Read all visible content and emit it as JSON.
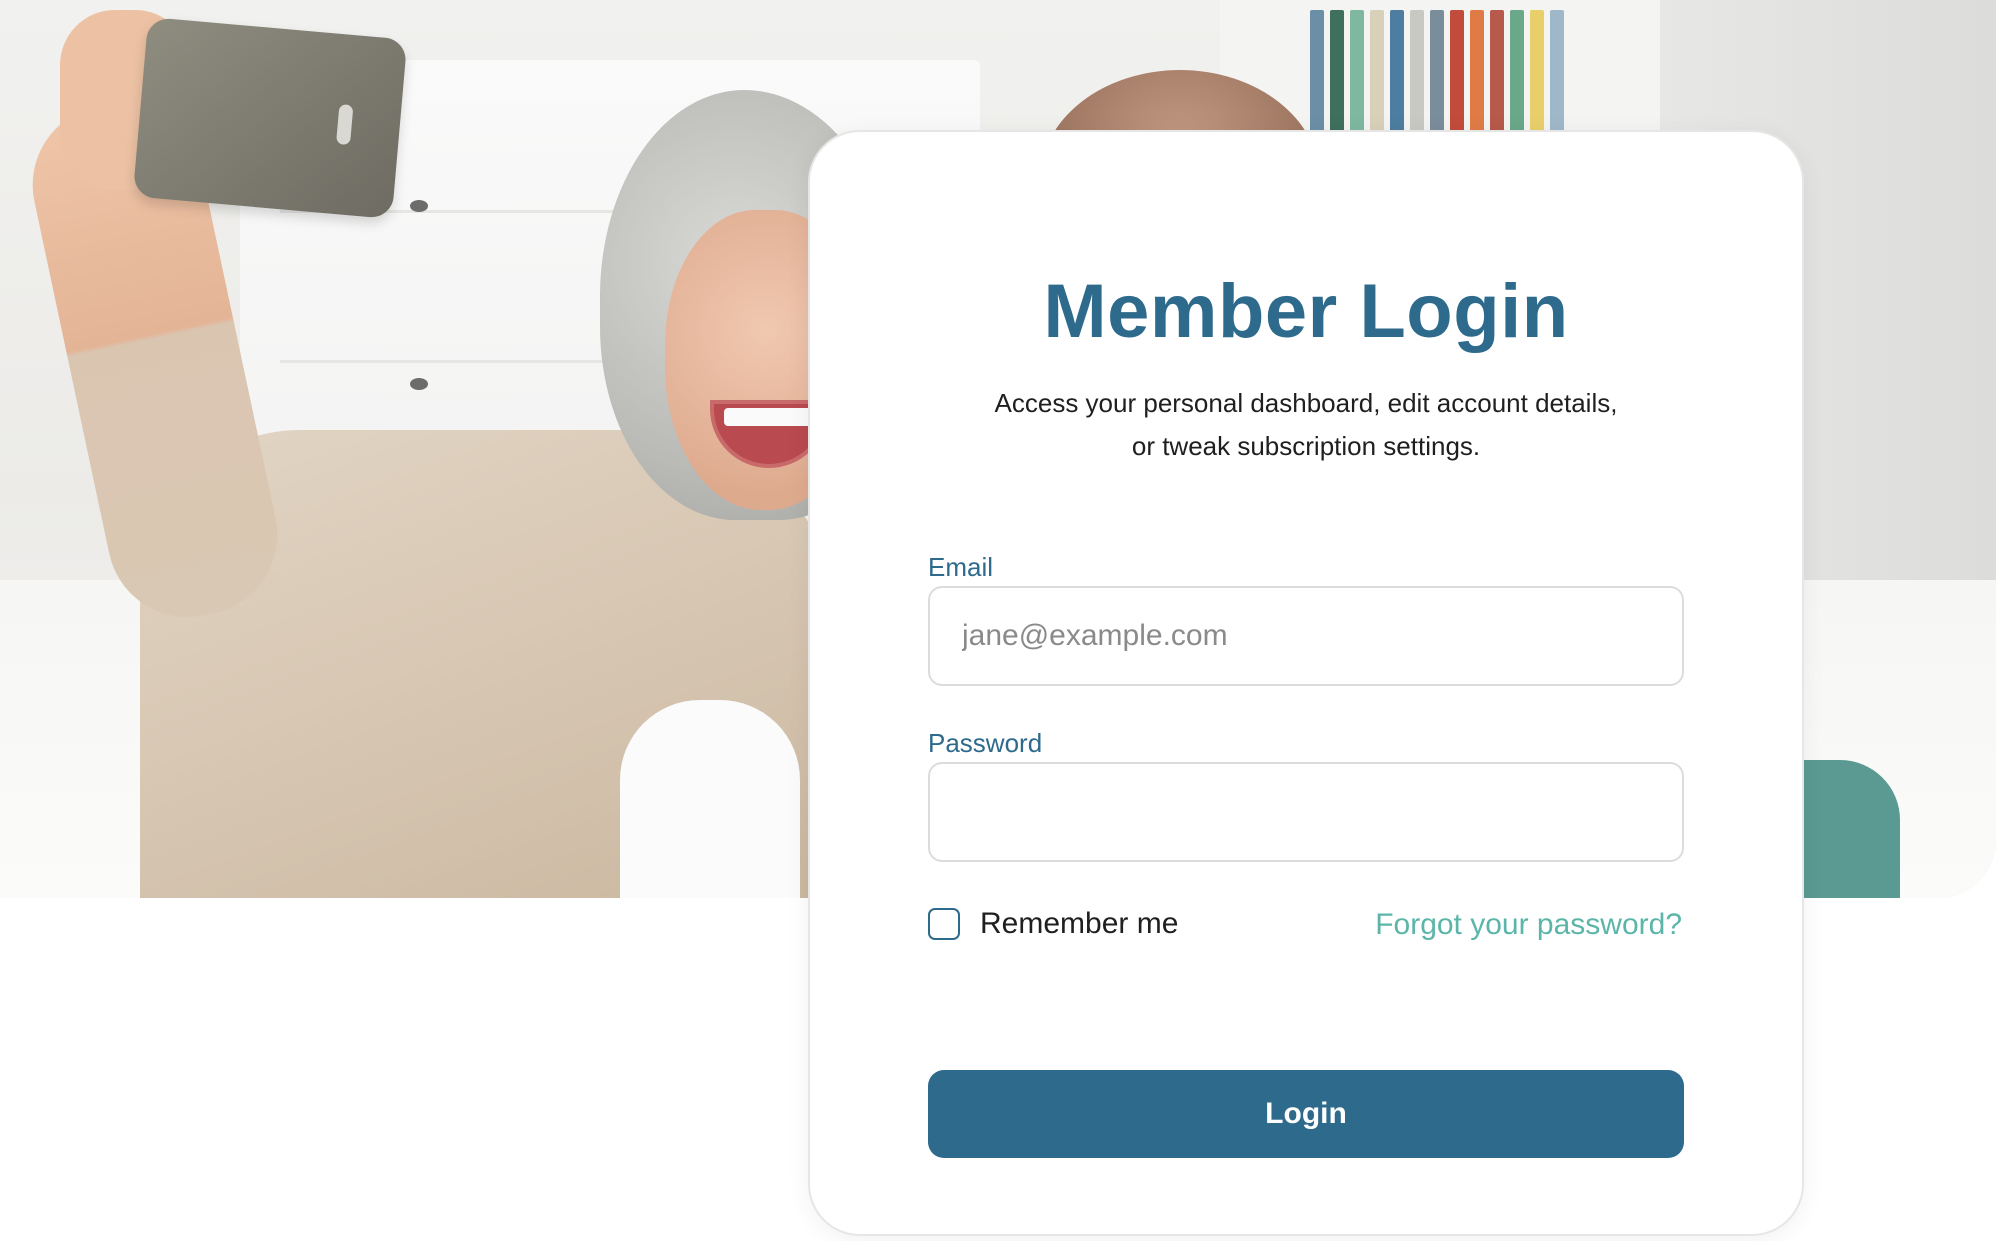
{
  "login": {
    "title": "Member Login",
    "subtitle": "Access your personal dashboard, edit account details, or tweak subscription settings.",
    "email": {
      "label": "Email",
      "placeholder": "jane@example.com",
      "value": ""
    },
    "password": {
      "label": "Password",
      "placeholder": "",
      "value": ""
    },
    "remember_me": {
      "label": "Remember me",
      "checked": false
    },
    "forgot_password_label": "Forgot your password?",
    "submit_label": "Login"
  },
  "colors": {
    "brand": "#2e6a8c",
    "accent_link": "#5bb5a8",
    "card_border": "#e6e6e6",
    "input_border": "#dcdcdc"
  },
  "hero": {
    "icon": "hero-photo-senior-couple-selfie"
  }
}
